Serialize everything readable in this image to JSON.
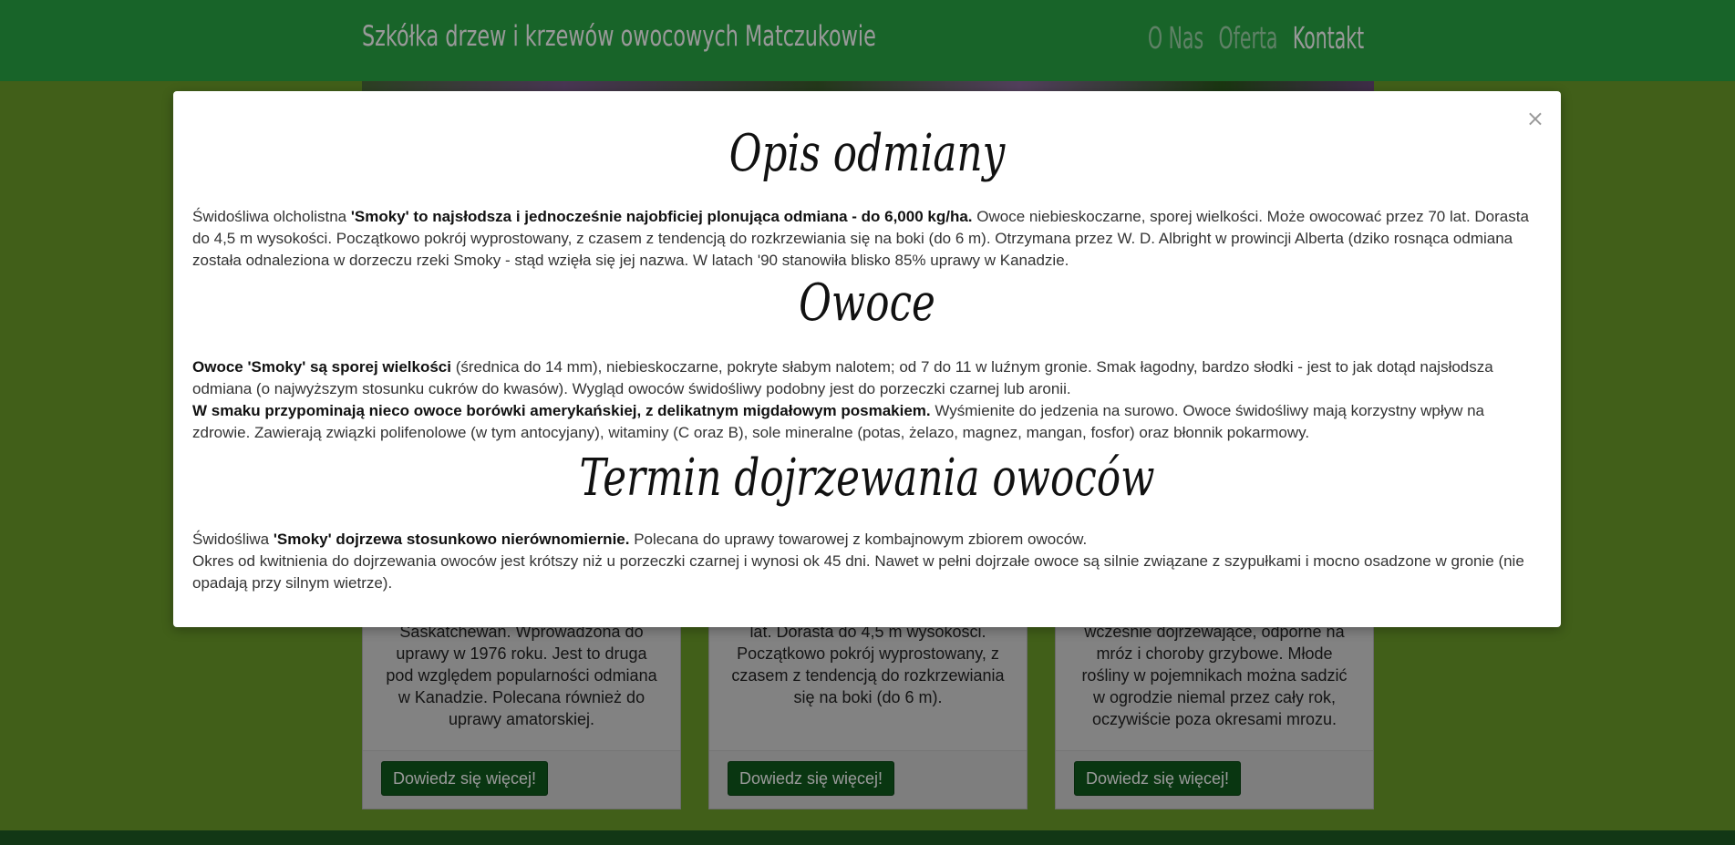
{
  "header": {
    "brand": "Szkółka drzew i krzewów owocowych Matczukowie",
    "nav": [
      {
        "label": "O Nas"
      },
      {
        "label": "Oferta"
      },
      {
        "label": "Kontakt"
      }
    ]
  },
  "cards": [
    {
      "text": "Saskatchewan. Wprowadzona do uprawy w 1976 roku. Jest to druga pod względem popularności odmiana w Kanadzie. Polecana również do uprawy amatorskiej.",
      "button": "Dowiedz się więcej!"
    },
    {
      "text": "lat. Dorasta do 4,5 m wysokości. Początkowo pokrój wyprostowany, z czasem z tendencją do rozkrzewiania się na boki (do 6 m).",
      "button": "Dowiedz się więcej!"
    },
    {
      "text": "wcześnie dojrzewające, odporne na mróz i choroby grzybowe. Młode rośliny w pojemnikach można sadzić w ogrodzie niemal przez cały rok, oczywiście poza okresami mrozu.",
      "button": "Dowiedz się więcej!"
    }
  ],
  "modal": {
    "close": "×",
    "sections": [
      {
        "title": "Opis odmiany",
        "p1_pre": "Świdośliwa olcholistna ",
        "p1_bold": "'Smoky' to najsłodsza i jednocześnie najobficiej plonująca odmiana - do 6,000 kg/ha.",
        "p1_post": " Owoce niebieskoczarne, sporej wielkości. Może owocować przez 70 lat. Dorasta do 4,5 m wysokości. Początkowo pokrój wyprostowany, z czasem z tendencją do rozkrzewiania się na boki (do 6 m). Otrzymana przez W. D. Albright w prowincji Alberta (dziko rosnąca odmiana została odnaleziona w dorzeczu rzeki Smoky - stąd wzięła się jej nazwa. W latach '90 stanowiła blisko 85% uprawy w Kanadzie."
      },
      {
        "title": "Owoce",
        "p1_bold": "Owoce 'Smoky' są sporej wielkości",
        "p1_post": " (średnica do 14 mm), niebieskoczarne, pokryte słabym nalotem; od 7 do 11 w luźnym gronie. Smak łagodny, bardzo słodki - jest to jak dotąd najsłodsza odmiana (o najwyższym stosunku cukrów do kwasów). Wygląd owoców świdośliwy podobny jest do porzeczki czarnej lub aronii.",
        "p2_bold": "W smaku przypominają nieco owoce borówki amerykańskiej, z delikatnym migdałowym posmakiem.",
        "p2_post": " Wyśmienite do jedzenia na surowo. Owoce świdośliwy mają korzystny wpływ na zdrowie. Zawierają związki polifenolowe (w tym antocyjany), witaminy (C oraz B), sole mineralne (potas, żelazo, magnez, mangan, fosfor) oraz błonnik pokarmowy."
      },
      {
        "title": "Termin dojrzewania owoców",
        "p1_pre": "Świdośliwa ",
        "p1_bold": "'Smoky' dojrzewa stosunkowo nierównomiernie.",
        "p1_post": " Polecana do uprawy towarowej z kombajnowym zbiorem owoców.",
        "p2": "Okres od kwitnienia do dojrzewania owoców jest krótszy niż u porzeczki czarnej i wynosi ok 45 dni. Nawet w pełni dojrzałe owoce są silnie związane z szypułkami i mocno osadzone w gronie (nie opadają przy silnym wietrze)."
      }
    ]
  }
}
